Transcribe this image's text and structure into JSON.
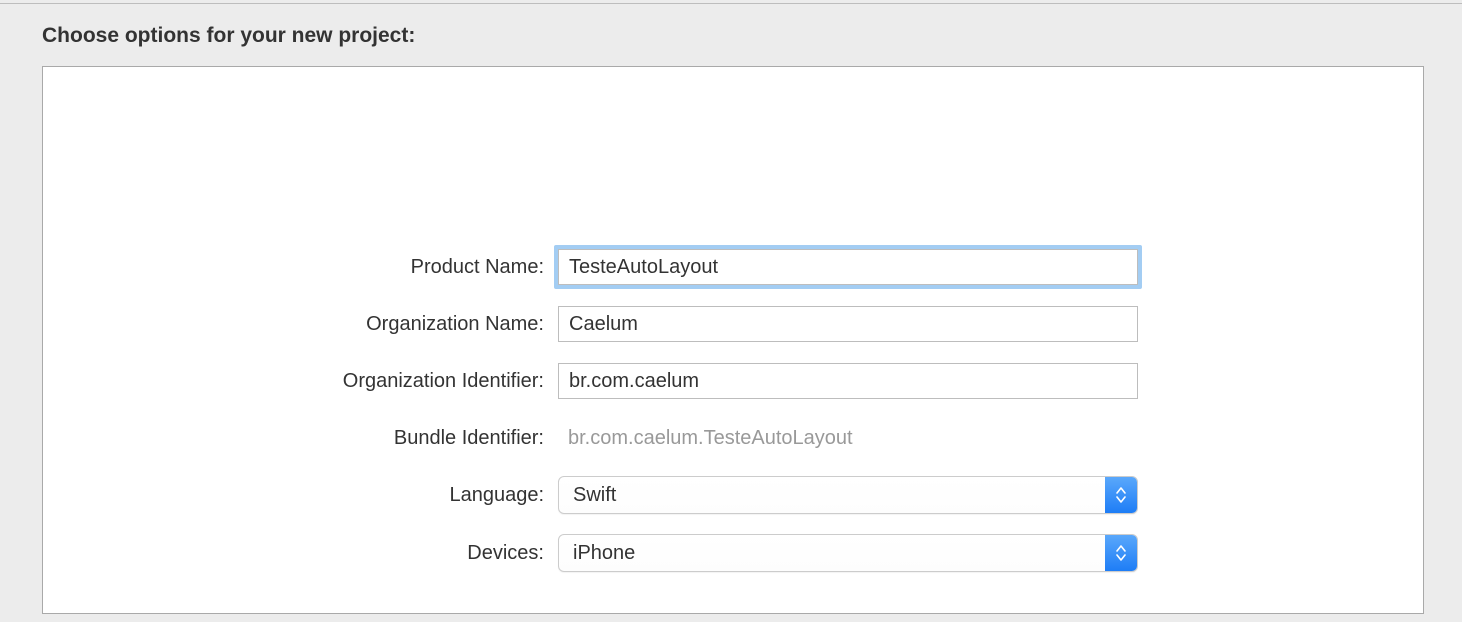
{
  "heading": "Choose options for your new project:",
  "form": {
    "product_name": {
      "label": "Product Name:",
      "value": "TesteAutoLayout"
    },
    "organization_name": {
      "label": "Organization Name:",
      "value": "Caelum"
    },
    "organization_identifier": {
      "label": "Organization Identifier:",
      "value": "br.com.caelum"
    },
    "bundle_identifier": {
      "label": "Bundle Identifier:",
      "value": "br.com.caelum.TesteAutoLayout"
    },
    "language": {
      "label": "Language:",
      "value": "Swift"
    },
    "devices": {
      "label": "Devices:",
      "value": "iPhone"
    }
  }
}
